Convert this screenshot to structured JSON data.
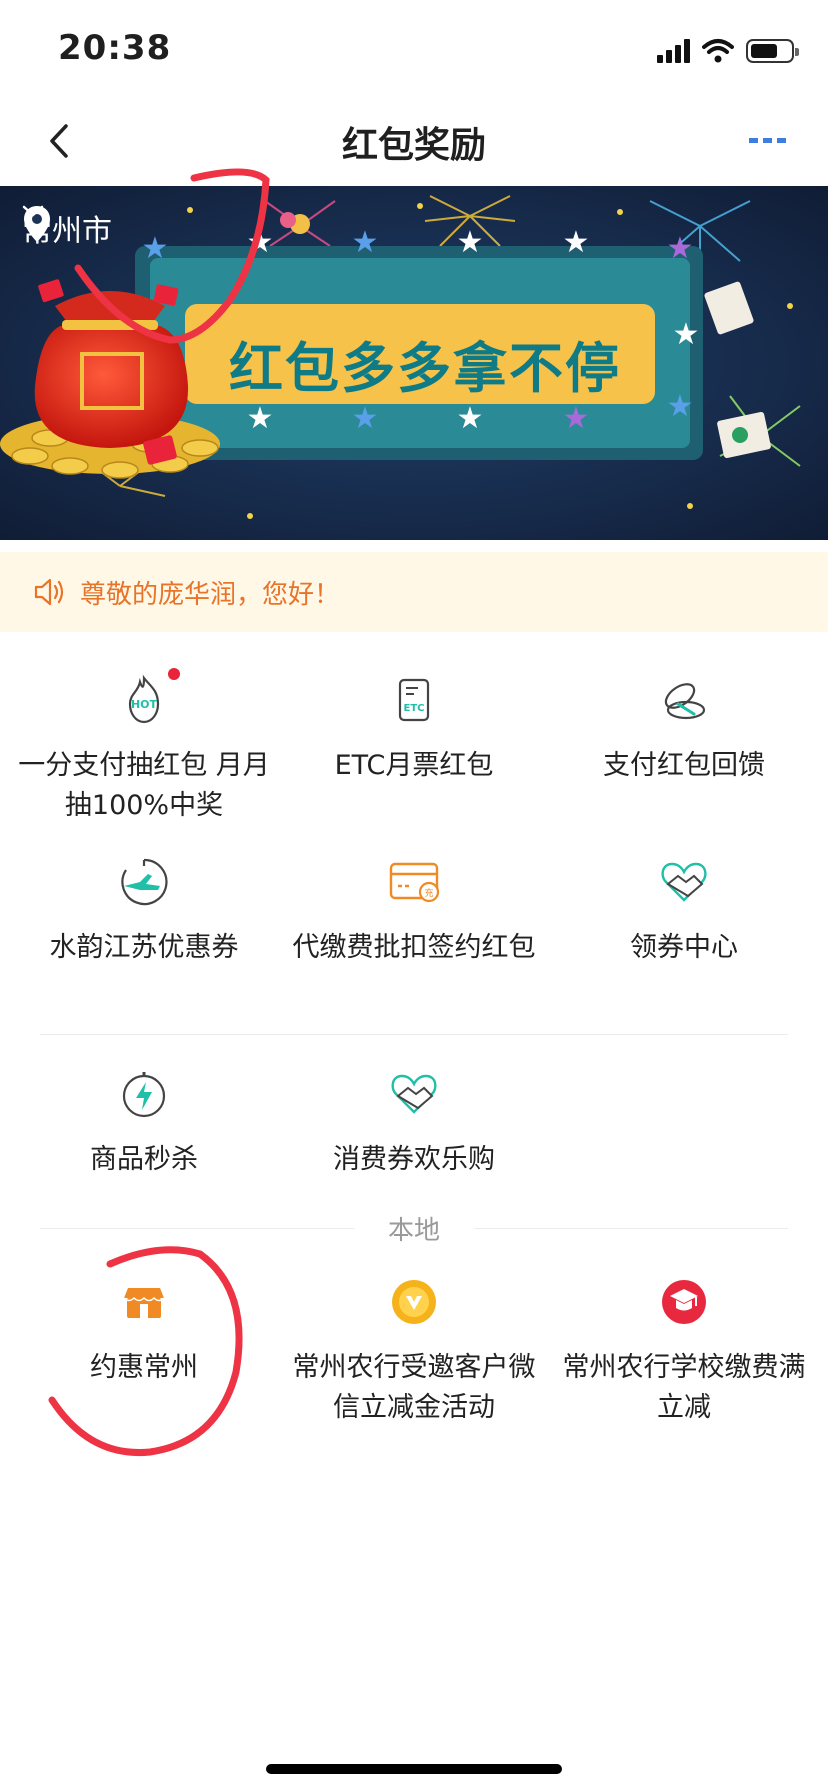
{
  "status_bar": {
    "time": "20:38"
  },
  "nav": {
    "title": "红包奖励"
  },
  "banner": {
    "city": "常州市",
    "slogan": "红包多多拿不停"
  },
  "notice": {
    "text": "尊敬的庞华润，您好！"
  },
  "services": [
    {
      "label": "一分支付抽红包 月月抽100%中奖",
      "icon": "hot-flame-icon",
      "badge": "red-dot"
    },
    {
      "label": "ETC月票红包",
      "icon": "etc-card-icon"
    },
    {
      "label": "支付红包回馈",
      "icon": "coin-stack-icon"
    },
    {
      "label": "水韵江苏优惠券",
      "icon": "travel-plane-icon"
    },
    {
      "label": "代缴费批扣签约红包",
      "icon": "recharge-card-icon"
    },
    {
      "label": "领券中心",
      "icon": "handshake-heart-icon"
    },
    {
      "label": "商品秒杀",
      "icon": "flash-timer-icon"
    },
    {
      "label": "消费券欢乐购",
      "icon": "handshake-heart-icon"
    }
  ],
  "local_section": {
    "title": "本地",
    "items": [
      {
        "label": "约惠常州",
        "icon": "shop-icon"
      },
      {
        "label": "常州农行受邀客户微信立减金活动",
        "icon": "v-coin-icon"
      },
      {
        "label": "常州农行学校缴费满立减",
        "icon": "graduation-icon"
      }
    ]
  },
  "colors": {
    "accent_orange": "#f08a24",
    "notice_text": "#e8742a",
    "notice_bg": "#fff8e6",
    "teal_icon": "#1fbfa8",
    "banner_bg": "#172a4a",
    "annotation_red": "#ee3344"
  }
}
